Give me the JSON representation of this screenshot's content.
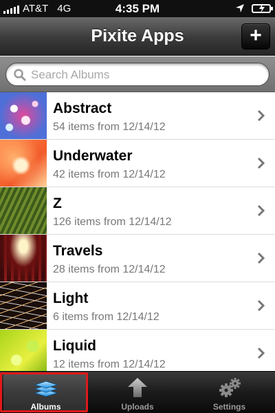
{
  "status_bar": {
    "carrier": "AT&T",
    "network": "4G",
    "time": "4:35 PM",
    "icons": [
      "signal-icon",
      "location-icon",
      "battery-charging-icon"
    ]
  },
  "nav_bar": {
    "title": "Pixite Apps",
    "add_label": "+"
  },
  "search": {
    "placeholder": "Search Albums",
    "value": ""
  },
  "albums": [
    {
      "name": "Abstract",
      "subtitle": "54 items from 12/14/12"
    },
    {
      "name": "Underwater",
      "subtitle": "42 items from 12/14/12"
    },
    {
      "name": "Z",
      "subtitle": "126 items from 12/14/12"
    },
    {
      "name": "Travels",
      "subtitle": "28 items from 12/14/12"
    },
    {
      "name": "Light",
      "subtitle": "6 items from 12/14/12"
    },
    {
      "name": "Liquid",
      "subtitle": "12 items from 12/14/12"
    }
  ],
  "tab_bar": {
    "selected": "albums",
    "highlight_color": "#e0191a",
    "tabs": [
      {
        "label": "Albums",
        "icon": "stacked-layers-icon"
      },
      {
        "label": "Uploads",
        "icon": "upload-arrow-icon"
      },
      {
        "label": "Settings",
        "icon": "gears-icon"
      }
    ]
  }
}
